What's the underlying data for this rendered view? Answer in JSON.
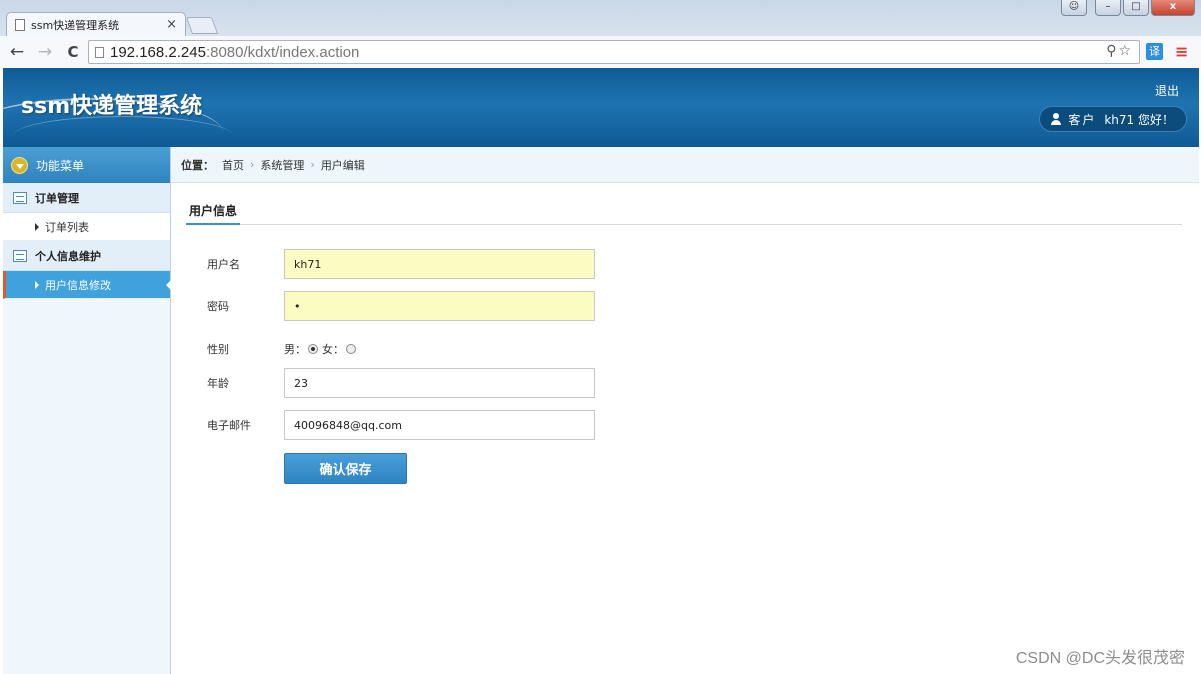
{
  "browser": {
    "tab_title": "ssm快递管理系统",
    "tab_close": "×",
    "url_host": "192.168.2.245",
    "url_rest": ":8080/kdxt/index.action",
    "back": "←",
    "forward": "→",
    "reload": "C",
    "omni_icons": "⚲☆",
    "ext_label": "译",
    "menu": "≡",
    "win_minimize": "–",
    "win_maximize": "□",
    "win_close": "x"
  },
  "header": {
    "title": "ssm快递管理系统",
    "logout": "退出",
    "role": "客户",
    "user_greeting": "kh71 您好！"
  },
  "sidebar": {
    "heading": "功能菜单",
    "groups": [
      {
        "label": "订单管理",
        "items": [
          {
            "label": "订单列表"
          }
        ]
      },
      {
        "label": "个人信息维护",
        "items": [
          {
            "label": "用户信息修改",
            "active": true
          }
        ]
      }
    ]
  },
  "breadcrumb": {
    "label": "位置：",
    "items": [
      "首页",
      "系统管理",
      "用户编辑"
    ],
    "sep": "›"
  },
  "main": {
    "section_title": "用户信息",
    "form": {
      "username_label": "用户名",
      "username_value": "kh71",
      "password_label": "密码",
      "password_value": "•",
      "gender_label": "性别",
      "gender_male": "男：",
      "gender_female": "女：",
      "age_label": "年龄",
      "age_value": "23",
      "email_label": "电子邮件",
      "email_value": "40096848@qq.com"
    },
    "save_button": "确认保存"
  },
  "watermark": "CSDN @DC头发很茂密",
  "colors": {
    "header_blue": "#1e74b1",
    "active_item": "#3fa2dc",
    "button_blue": "#2f84c3",
    "input_yellow": "#fbfcc2"
  }
}
